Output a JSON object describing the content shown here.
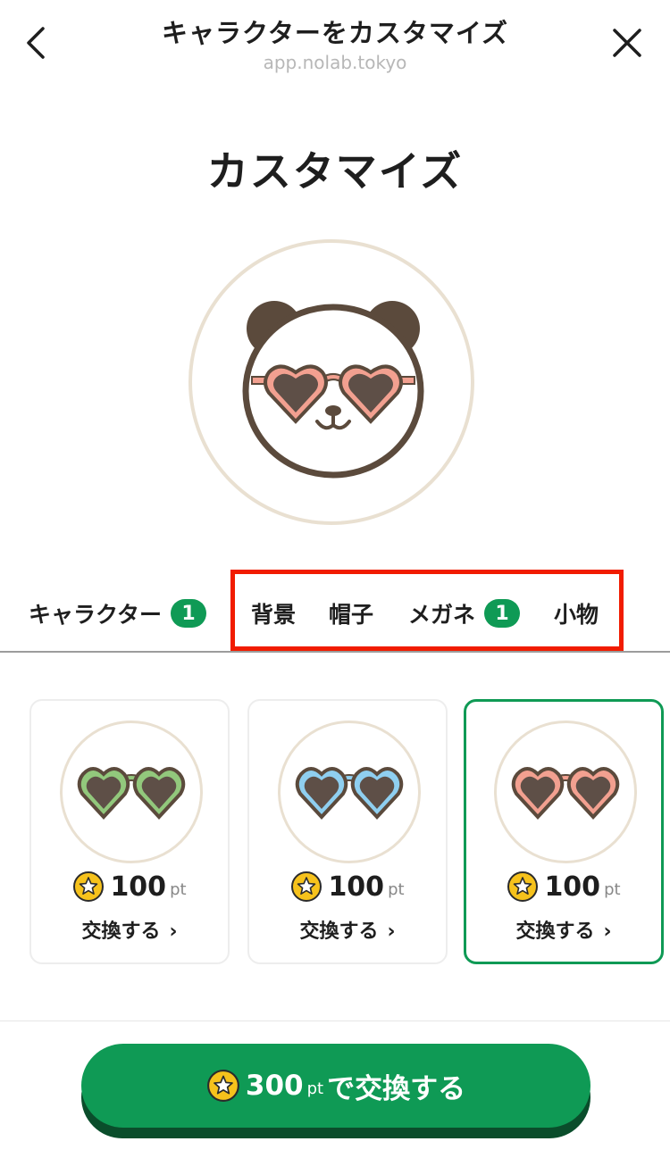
{
  "header": {
    "title": "キャラクターをカスタマイズ",
    "url": "app.nolab.tokyo"
  },
  "page_title": "カスタマイズ",
  "tabs": [
    {
      "label": "キャラクター",
      "badge": "1"
    },
    {
      "label": "背景"
    },
    {
      "label": "帽子"
    },
    {
      "label": "メガネ",
      "badge": "1"
    },
    {
      "label": "小物"
    }
  ],
  "items": [
    {
      "price": "100",
      "unit": "pt",
      "action": "交換する",
      "lens_color": "#92c87c",
      "selected": false
    },
    {
      "price": "100",
      "unit": "pt",
      "action": "交換する",
      "lens_color": "#8fcff0",
      "selected": false
    },
    {
      "price": "100",
      "unit": "pt",
      "action": "交換する",
      "lens_color": "#f2a090",
      "selected": true
    }
  ],
  "cta": {
    "points": "300",
    "unit": "pt",
    "label": "で交換する"
  },
  "colors": {
    "accent": "#0f9a55",
    "highlight": "#f11c00",
    "brown": "#5b4a3c",
    "coin": "#f6c21c"
  }
}
